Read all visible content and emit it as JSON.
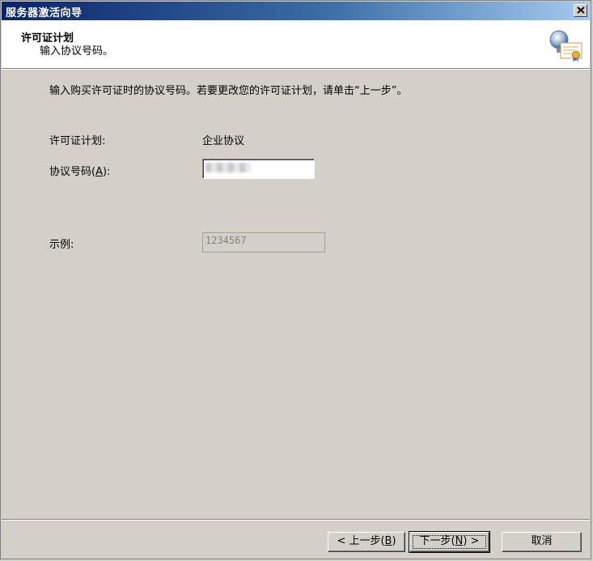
{
  "window": {
    "title": "服务器激活向导"
  },
  "header": {
    "title": "许可证计划",
    "subtitle": "输入协议号码。"
  },
  "main": {
    "instruction": "输入购买许可证时的协议号码。若要更改您的许可证计划，请单击“上一步”。",
    "plan_label": "许可证计划:",
    "plan_value": "企业协议",
    "agreement_label": "协议号码(A):",
    "agreement_value": "",
    "example_label": "示例:",
    "example_value": "1234567"
  },
  "footer": {
    "back_label": "< 上一步(B)",
    "next_label": "下一步(N) >",
    "cancel_label": "取消"
  },
  "icons": {
    "close": "close-icon",
    "header": "certificate-icon"
  }
}
